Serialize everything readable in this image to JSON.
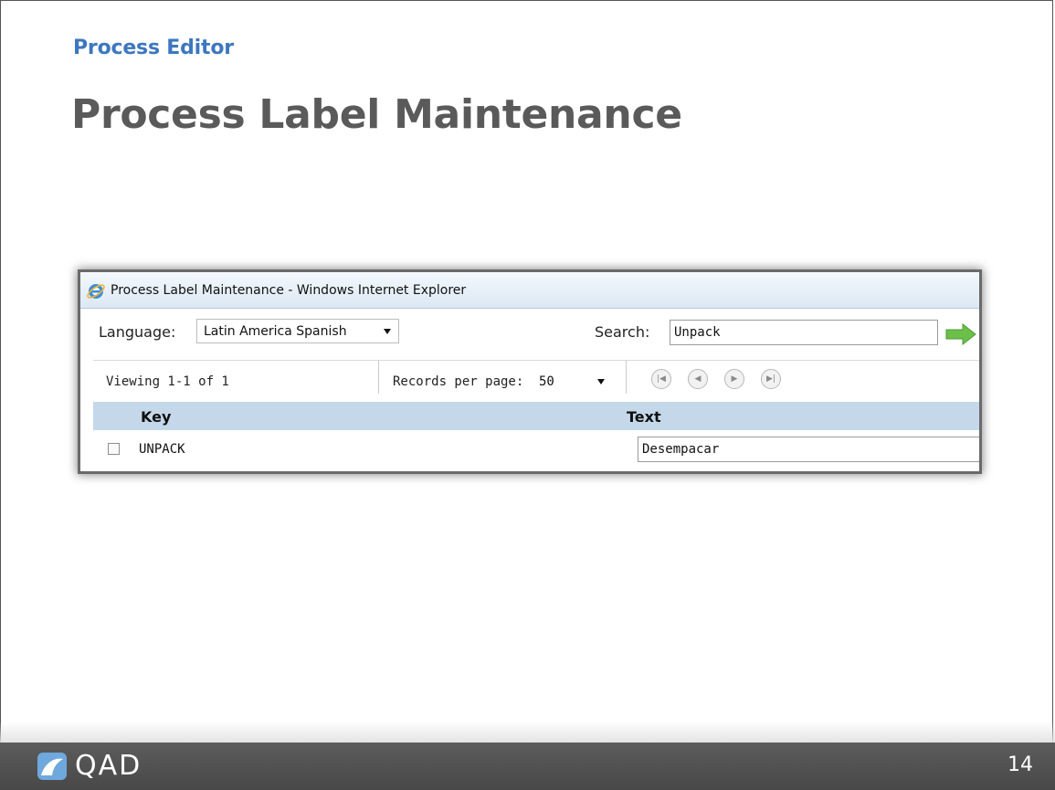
{
  "slide": {
    "subtitle": "Process Editor",
    "title": "Process Label Maintenance",
    "page_number": "14",
    "logo_text": "QAD"
  },
  "browser": {
    "window_title": "Process Label Maintenance - Windows Internet Explorer"
  },
  "toolbar": {
    "language_label": "Language:",
    "language_value": "Latin America Spanish",
    "search_label": "Search:",
    "search_value": "Unpack"
  },
  "pager": {
    "viewing_text": "Viewing 1-1 of 1",
    "records_per_page_label": "Records per page:",
    "records_per_page_value": "50"
  },
  "grid": {
    "columns": [
      "Key",
      "Text"
    ],
    "rows": [
      {
        "key": "UNPACK",
        "text": "Desempacar",
        "checked": false
      }
    ]
  },
  "colors": {
    "subtitle": "#3d77bf",
    "title": "#5a5a5a",
    "grid_header_bg": "#c5d8ea",
    "footer_bg": "#505050",
    "go_arrow": "#6cc04a"
  }
}
